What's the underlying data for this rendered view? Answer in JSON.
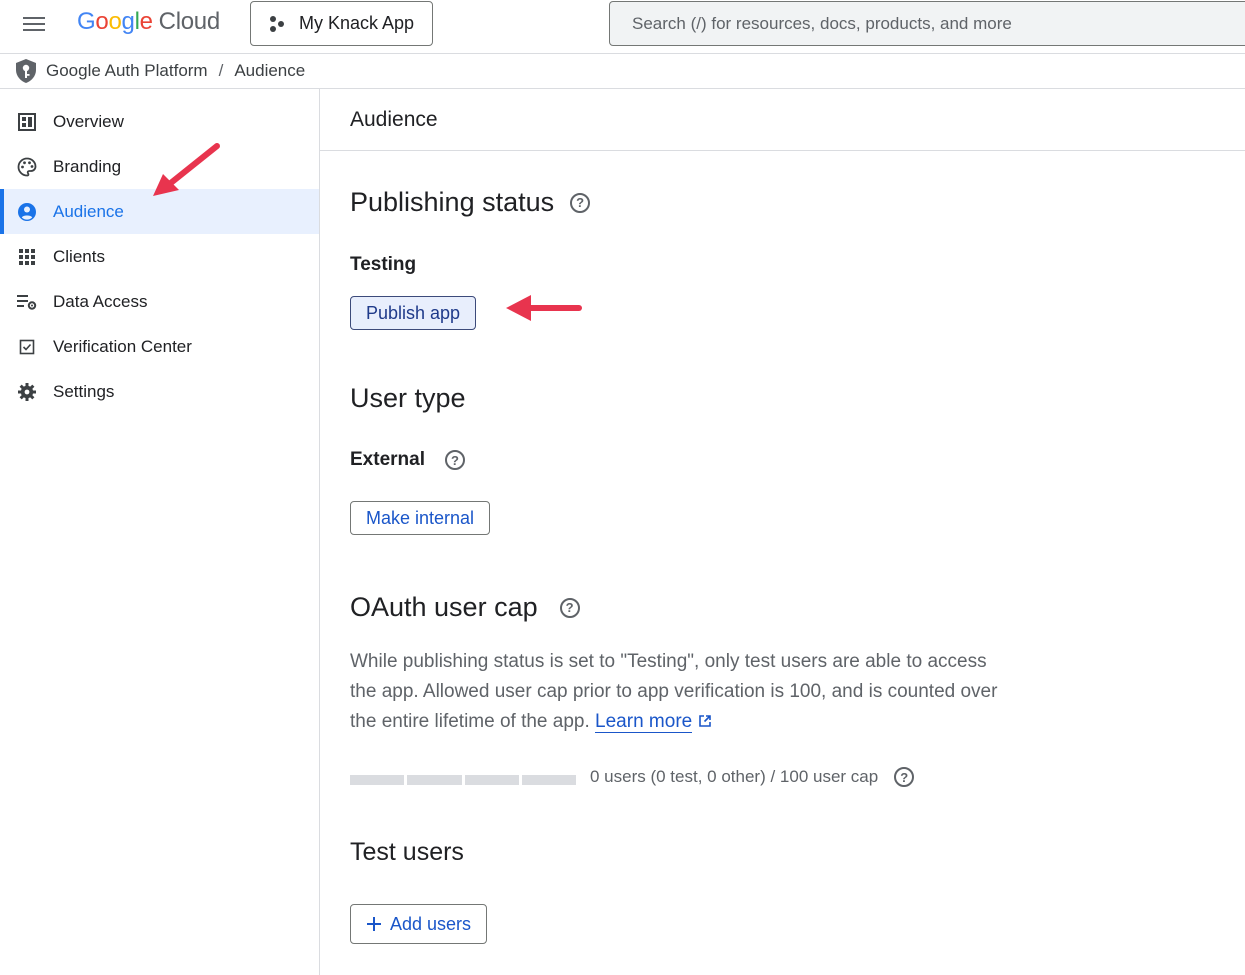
{
  "topbar": {
    "logo_letters": [
      "G",
      "o",
      "o",
      "g",
      "l",
      "e"
    ],
    "logo_product": "Cloud",
    "project_name": "My Knack App",
    "search_placeholder": "Search (/) for resources, docs, products, and more"
  },
  "breadcrumb": {
    "platform": "Google Auth Platform",
    "separator": "/",
    "current": "Audience"
  },
  "sidebar": {
    "items": [
      {
        "label": "Overview",
        "icon": "dashboard-icon",
        "active": false
      },
      {
        "label": "Branding",
        "icon": "palette-icon",
        "active": false
      },
      {
        "label": "Audience",
        "icon": "person-circle-icon",
        "active": true
      },
      {
        "label": "Clients",
        "icon": "grid-icon",
        "active": false
      },
      {
        "label": "Data Access",
        "icon": "list-settings-icon",
        "active": false
      },
      {
        "label": "Verification Center",
        "icon": "checkbox-icon",
        "active": false
      },
      {
        "label": "Settings",
        "icon": "gear-icon",
        "active": false
      }
    ]
  },
  "main": {
    "page_title": "Audience",
    "publishing": {
      "title": "Publishing status",
      "status": "Testing",
      "button": "Publish app"
    },
    "user_type": {
      "title": "User type",
      "value": "External",
      "button": "Make internal"
    },
    "oauth_cap": {
      "title": "OAuth user cap",
      "description": "While publishing status is set to \"Testing\", only test users are able to access the app. Allowed user cap prior to app verification is 100, and is counted over the entire lifetime of the app.",
      "link": "Learn more",
      "usage_text": "0 users (0 test, 0 other) / 100 user cap",
      "usage_fraction": 0
    },
    "test_users": {
      "title": "Test users",
      "button": "Add users"
    }
  },
  "colors": {
    "accent": "#1a73e8",
    "annotation_arrow": "#e8344e"
  }
}
